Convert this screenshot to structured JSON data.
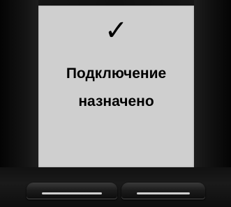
{
  "status": {
    "icon": "checkmark-icon",
    "glyph": "✓"
  },
  "message": {
    "line1": "Подключение",
    "line2": "назначено"
  },
  "softkeys": {
    "left_icon": "dash-icon",
    "right_icon": "dash-icon"
  },
  "colors": {
    "screen_bg": "#cfcfcf",
    "text": "#000000",
    "bezel": "#111111"
  }
}
